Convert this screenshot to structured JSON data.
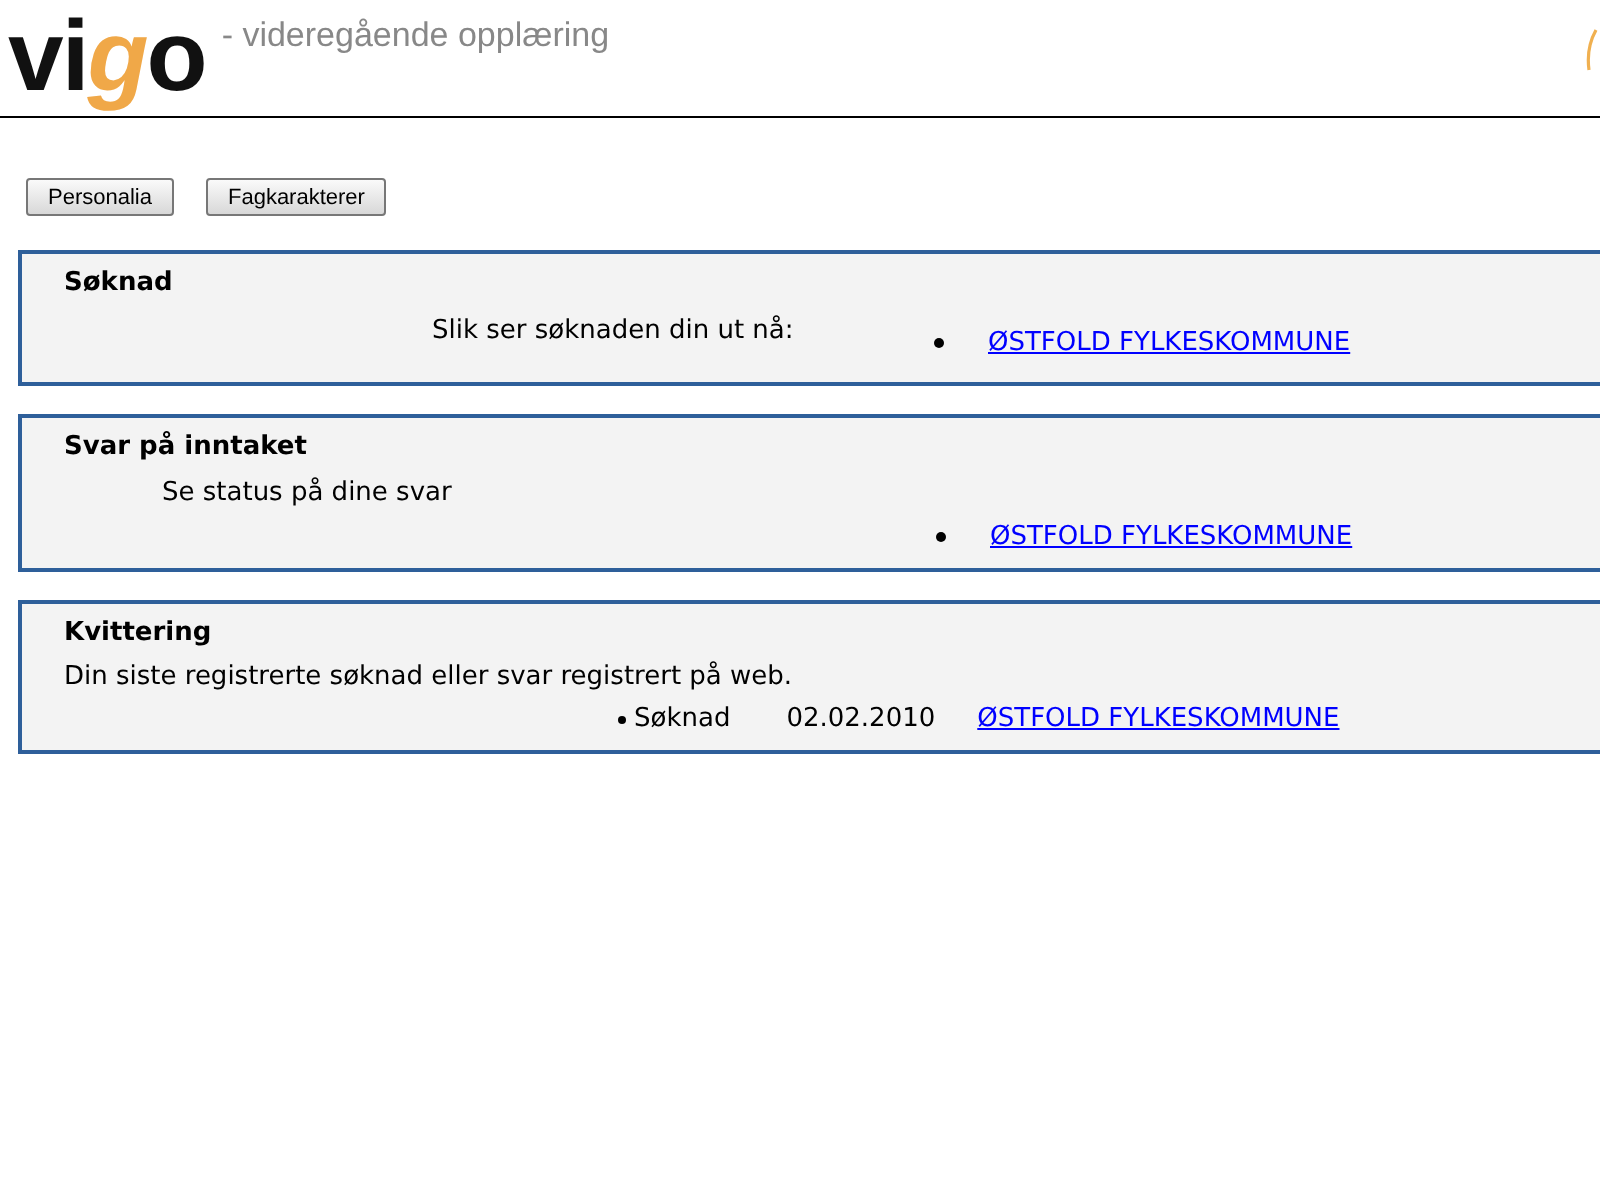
{
  "logo": {
    "text": "vigo",
    "tagline": "- videregående opplæring"
  },
  "buttons": [
    {
      "label": "Personalia"
    },
    {
      "label": "Fagkarakterer"
    }
  ],
  "panels": [
    {
      "kind": "application",
      "title": "Søknad",
      "intro": "Slik ser søknaden din ut nå:",
      "items": [
        {
          "link": "ØSTFOLD FYLKESKOMMUNE"
        }
      ]
    },
    {
      "kind": "answers",
      "title": "Svar på inntaket",
      "intro": "Se status på dine svar",
      "items": [
        {
          "link": "ØSTFOLD FYLKESKOMMUNE"
        }
      ]
    },
    {
      "kind": "receipt",
      "title": "Kvittering",
      "intro": "Din siste registrerte søknad eller svar registrert på web.",
      "items": [
        {
          "type": "Søknad",
          "date": "02.02.2010",
          "link": "ØSTFOLD FYLKESKOMMUNE"
        }
      ]
    }
  ]
}
